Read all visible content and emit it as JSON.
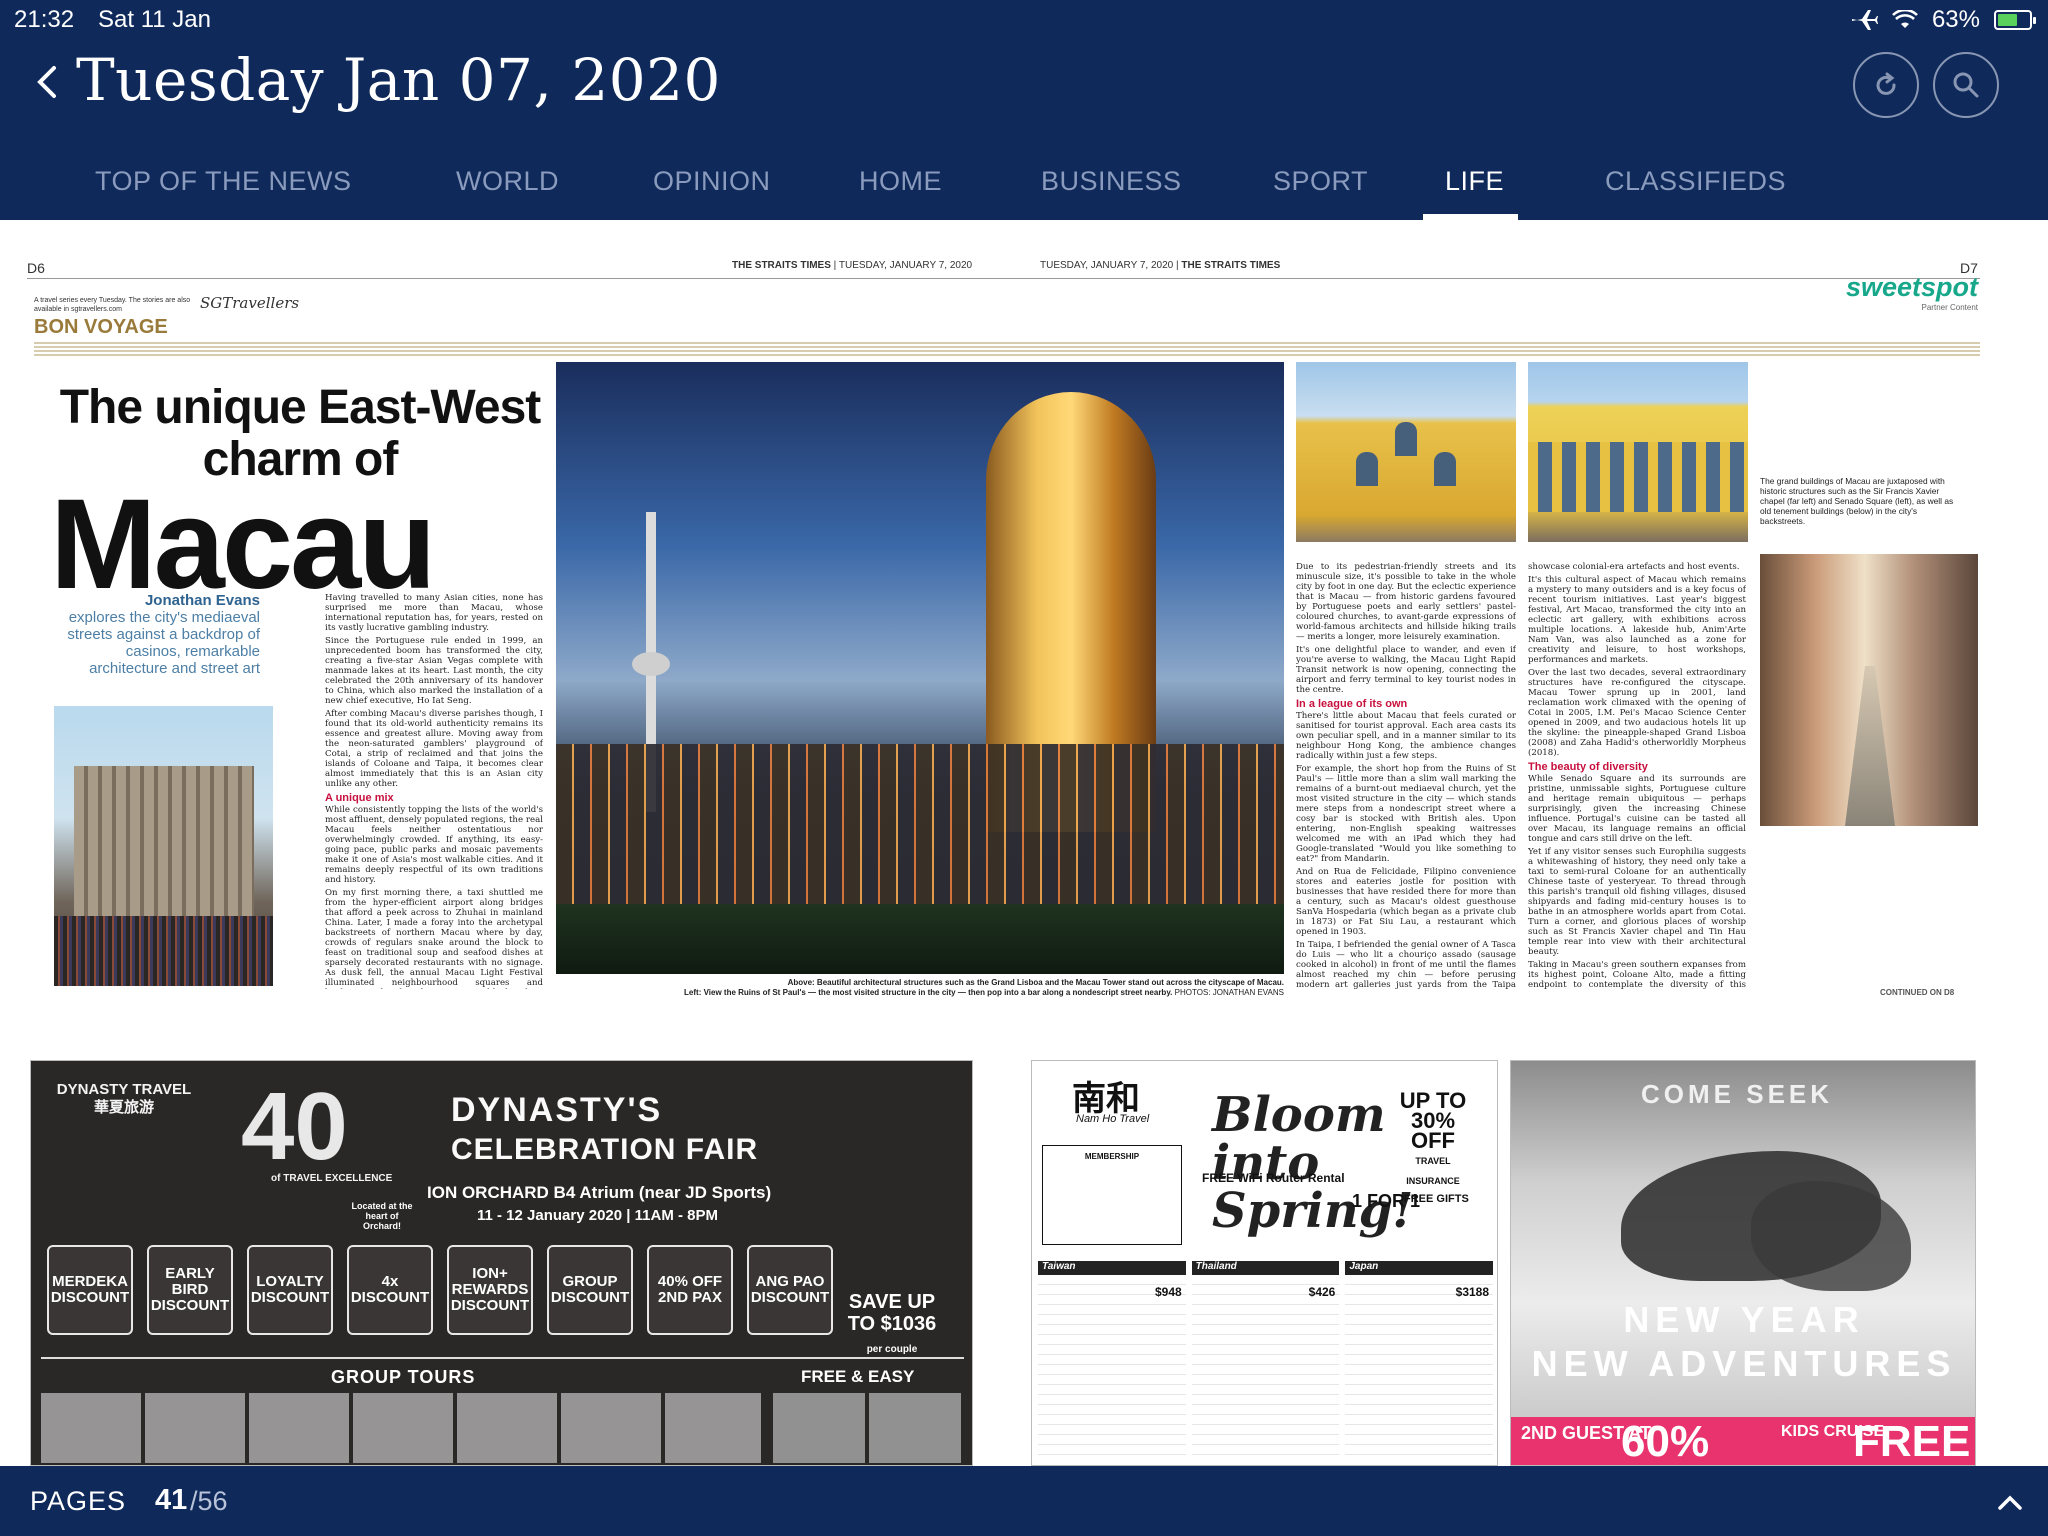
{
  "status_bar": {
    "time": "21:32",
    "date": "Sat 11 Jan",
    "battery_percent": "63%",
    "battery_level": 0.63,
    "icons": [
      "airplane-icon",
      "wifi-icon",
      "battery-icon"
    ]
  },
  "header": {
    "title": "Tuesday Jan 07, 2020",
    "icons": [
      "back-icon",
      "refresh-icon",
      "search-icon"
    ]
  },
  "nav": {
    "tabs": [
      {
        "label": "TOP OF THE NEWS"
      },
      {
        "label": "WORLD"
      },
      {
        "label": "OPINION"
      },
      {
        "label": "HOME"
      },
      {
        "label": "BUSINESS"
      },
      {
        "label": "SPORT"
      },
      {
        "label": "LIFE"
      },
      {
        "label": "CLASSIFIEDS"
      }
    ],
    "active": "LIFE"
  },
  "page": {
    "left_page": "D6",
    "right_page": "D7",
    "head_left_paper": "THE STRAITS TIMES",
    "head_left_date": "TUESDAY, JANUARY 7, 2020",
    "head_right_date": "TUESDAY, JANUARY 7, 2020",
    "head_right_paper": "THE STRAITS TIMES",
    "series_note": "A travel series every Tuesday. The stories are also available in sgtravellers.com",
    "travellers_logo": "SGTravellers",
    "kicker": "BON VOYAGE",
    "sweetspot_logo": "sweetspot",
    "sweetspot_sub": "Partner Content"
  },
  "article": {
    "headline_top": "The unique East-West charm of",
    "headline_big": "Macau",
    "byline": "Jonathan Evans",
    "standfirst": "explores the city's mediaeval streets against a backdrop of casinos, remarkable architecture and street art",
    "col1_p1": "Having travelled to many Asian cities, none has surprised me more than Macau, whose international reputation has, for years, rested on its vastly lucrative gambling industry.",
    "col1_p2": "Since the Portuguese rule ended in 1999, an unprecedented boom has transformed the city, creating a five-star Asian Vegas complete with manmade lakes at its heart. Last month, the city celebrated the 20th anniversary of its handover to China, which also marked the installation of a new chief executive, Ho Iat Seng.",
    "col1_p3": "After combing Macau's diverse parishes though, I found that its old-world authenticity remains its essence and greatest allure. Moving away from the neon-saturated gamblers' playground of Cotai, a strip of reclaimed and that joins the islands of Coloane and Taipa, it becomes clear almost immediately that this is an Asian city unlike any other.",
    "crosshead1": "A unique mix",
    "col1_p4": "While consistently topping the lists of the world's most affluent, densely populated regions, the real Macau feels neither ostentatious nor overwhelmingly crowded. If anything, its easy-going pace, public parks and mosaic pavements make it one of Asia's most walkable cities. And it remains deeply respectful of its own traditions and history.",
    "col1_p5": "On my first morning there, a taxi shuttled me from the hyper-efficient airport along bridges that afford a peek across to Zhuhai in mainland China. Later, I made a foray into the archetypal backstreets of northern Macau where by day, crowds of regulars snake around the block to feast on traditional soup and seafood dishes at sparsely decorated restaurants with no signage. As dusk fell, the annual Macau Light Festival illuminated neighbourhood squares and backstreets lined with street art, old churches, bijou cafés and boutiques.",
    "col2_p1": "Due to its pedestrian-friendly streets and its minuscule size, it's possible to take in the whole city by foot in one day. But the eclectic experience that is Macau — from historic gardens favoured by Portuguese poets and early settlers' pastel-coloured churches, to avant-garde expressions of world-famous architects and hillside hiking trails — merits a longer, more leisurely examination.",
    "col2_p2": "It's one delightful place to wander, and even if you're averse to walking, the Macau Light Rapid Transit network is now opening, connecting the airport and ferry terminal to key tourist nodes in the centre.",
    "crosshead2": "In a league of its own",
    "col2_p3": "There's little about Macau that feels curated or sanitised for tourist approval. Each area casts its own peculiar spell, and in a manner similar to its neighbour Hong Kong, the ambience changes radically within just a few steps.",
    "col2_p4": "For example, the short hop from the Ruins of St Paul's — little more than a slim wall marking the remains of a burnt-out mediaeval church, yet the most visited structure in the city — which stands mere steps from a nondescript street where a cosy bar is stocked with British ales. Upon entering, non-English speaking waitresses welcomed me with an iPad which they had Google-translated \"Would you like something to eat?\" from Mandarin.",
    "col2_p5": "And on Rua de Felicidade, Filipino convenience stores and eateries jostle for position with businesses that have resided there for more than a century, such as Macau's oldest guesthouse SanVa Hospedaria (which began as a private club in 1873) or Fat Siu Lau, a restaurant which opened in 1903.",
    "col2_p6": "In Taipa, I befriended the genial owner of A Tasca do Luis — who lit a chouriço assado (sausage cooked in alcohol) in front of me until the flames almost reached my chin — before perusing modern art galleries just yards from the Taipa Houses–Museum, five restored homes that now",
    "col3_p1": "showcase colonial-era artefacts and host events.",
    "col3_p2": "It's this cultural aspect of Macau which remains a mystery to many outsiders and is a key focus of recent tourism initiatives. Last year's biggest festival, Art Macao, transformed the city into an eclectic art gallery, with exhibitions across multiple locations. A lakeside hub, Anim'Arte Nam Van, was also launched as a zone for creativity and leisure, to host workshops, performances and markets.",
    "col3_p3": "Over the last two decades, several extraordinary structures have re-configured the cityscape. Macau Tower sprung up in 2001, land reclamation work climaxed with the opening of Cotai in 2005, I.M. Pei's Macao Science Center opened in 2009, and two audacious hotels lit up the skyline: the pineapple-shaped Grand Lisboa (2008) and Zaha Hadid's otherworldly Morpheus (2018).",
    "crosshead3": "The beauty of diversity",
    "col3_p4": "While Senado Square and its surrounds are pristine, unmissable sights, Portuguese culture and heritage remain ubiquitous — perhaps surprisingly, given the increasing Chinese influence. Portugal's cuisine can be tasted all over Macau, its language remains an official tongue and cars still drive on the left.",
    "col3_p5": "Yet if any visitor senses such Europhilia suggests a whitewashing of history, they need only take a taxi to semi-rural Coloane for an authentically Chinese taste of yesteryear. To thread through this parish's tranquil old fishing villages, disused shipyards and fading mid-century houses is to bathe in an atmosphere worlds apart from Cotai. Turn a corner, and glorious places of worship such as St Francis Xavier chapel and Tin Hau temple rear into view with their architectural beauty.",
    "col3_p6": "Taking in Macau's green southern expanses from its highest point, Coloane Alto, made a fitting endpoint to contemplate the diversity of this special administrative region — one that the non-gambling world is only beginning to wake up to.",
    "caption_main_above": "Above: Beautiful architectural structures such as the Grand Lisboa and the Macau Tower stand out across the cityscape of Macau.",
    "caption_main_left": "Left: View the Ruins of St Paul's — the most visited structure in the city — then pop into a bar along a nondescript street nearby.",
    "photo_credit": "PHOTOS: JONATHAN EVANS",
    "caption_side": "The grand buildings of Macau are juxtaposed with historic structures such as the Sir Francis Xavier chapel (far left) and Senado Square (left), as well as old tenement buildings (below) in the city's backstreets.",
    "continued": "CONTINUED ON D8"
  },
  "ads": {
    "dynasty": {
      "logo": "DYNASTY TRAVEL",
      "logo_cn": "華夏旅游",
      "anniversary": "40",
      "anniversary_sub": "of TRAVEL EXCELLENCE",
      "title": "DYNASTY'S",
      "subtitle": "CELEBRATION FAIR",
      "venue": "ION ORCHARD B4 Atrium (near JD Sports)",
      "dates": "11 - 12 January 2020 | 11AM - 8PM",
      "located": "Located at the heart of Orchard!",
      "badges": [
        "MERDEKA DISCOUNT",
        "EARLY BIRD DISCOUNT",
        "LOYALTY DISCOUNT",
        "4x DISCOUNT",
        "ION+ REWARDS DISCOUNT",
        "GROUP DISCOUNT",
        "40% OFF 2ND PAX",
        "ANG PAO DISCOUNT"
      ],
      "save": "SAVE UP TO $1036",
      "save_note": "per couple",
      "group_tours": "GROUP TOURS",
      "free_easy": "FREE & EASY"
    },
    "namho": {
      "logo": "南和",
      "logo_en": "Nam Ho Travel",
      "bloom": "Bloom into Spring!",
      "off": "UP TO 30% OFF",
      "off_sub": "TRAVEL INSURANCE",
      "membership": "MEMBERSHIP",
      "free": "FREE WiFi Router Rental",
      "one_for_one": "1 FOR 1",
      "gifts": "FREE GIFTS",
      "regions": [
        {
          "name": "Taiwan",
          "price": "$948"
        },
        {
          "name": "Thailand",
          "price": "$426"
        },
        {
          "name": "Japan",
          "price": "$3188"
        }
      ]
    },
    "comeseek": {
      "head": "COME SEEK",
      "tag1": "NEW YEAR",
      "tag2": "NEW ADVENTURES",
      "guest": "2ND GUEST AT",
      "pct": "60%",
      "kids": "KIDS CRUISE",
      "free": "FREE"
    }
  },
  "footer": {
    "label": "PAGES",
    "current": "41",
    "total": "/56",
    "icons": [
      "chevron-up-icon"
    ]
  }
}
